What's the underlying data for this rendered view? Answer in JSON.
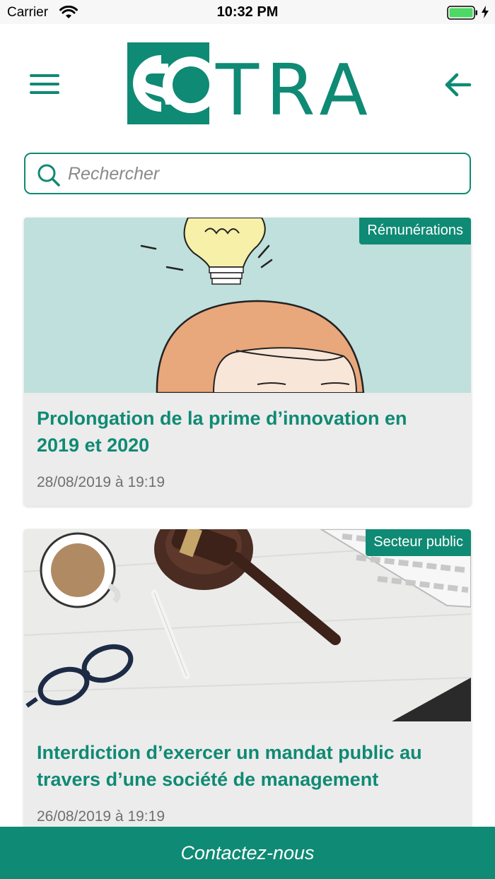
{
  "status_bar": {
    "carrier": "Carrier",
    "time": "10:32 PM"
  },
  "header": {
    "menu_icon": "hamburger-menu-icon",
    "back_icon": "arrow-left-icon",
    "logo_text": "SOTRA"
  },
  "search": {
    "placeholder": "Rechercher",
    "value": ""
  },
  "articles": [
    {
      "category": "Rémunérations",
      "title": "Prolongation de la prime d’innovation en 2019 et 2020",
      "date": "28/08/2019 à 19:19"
    },
    {
      "category": "Secteur public",
      "title": "Interdiction d’exercer un mandat public au travers d’une société de management",
      "date": "26/08/2019 à 19:19"
    }
  ],
  "footer": {
    "contact_label": "Contactez-nous"
  },
  "colors": {
    "brand": "#0f8a74",
    "card_bg": "#ececec",
    "date_text": "#707070"
  }
}
